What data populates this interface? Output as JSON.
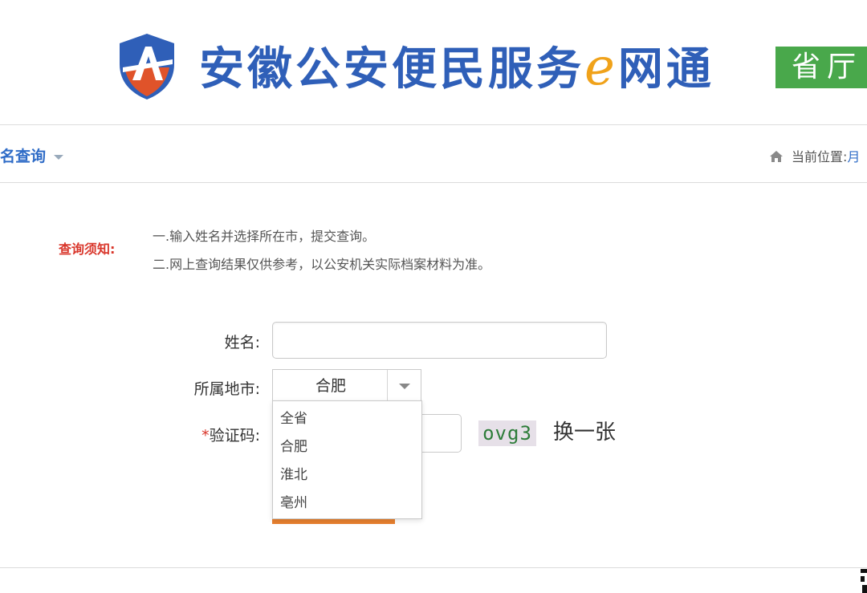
{
  "header": {
    "title_part1": "安徽公安便民服务",
    "title_e": "e",
    "title_part2": "网通",
    "tag": "省厅",
    "logo_icon": "police-shield-logo"
  },
  "subnav": {
    "title": "名查询",
    "location_prefix": "当前位置:",
    "location_link": "月"
  },
  "notice": {
    "label": "查询须知:",
    "lines": [
      "一.输入姓名并选择所在市，提交查询。",
      "二.网上查询结果仅供参考，以公安机关实际档案材料为准。"
    ]
  },
  "form": {
    "name_label": "姓名:",
    "name_value": "",
    "city_label": "所属地市:",
    "city_selected": "合肥",
    "code_required_mark": "*",
    "code_label": "验证码:",
    "code_value": "",
    "captcha_text": "ovg3",
    "refresh_label": "换一张",
    "city_options": [
      "全省",
      "合肥",
      "淮北",
      "亳州"
    ]
  },
  "colors": {
    "brand_blue": "#2f5fb8",
    "tag_green": "#49a84b",
    "accent_orange": "#e8802f",
    "notice_red": "#d9362b"
  }
}
